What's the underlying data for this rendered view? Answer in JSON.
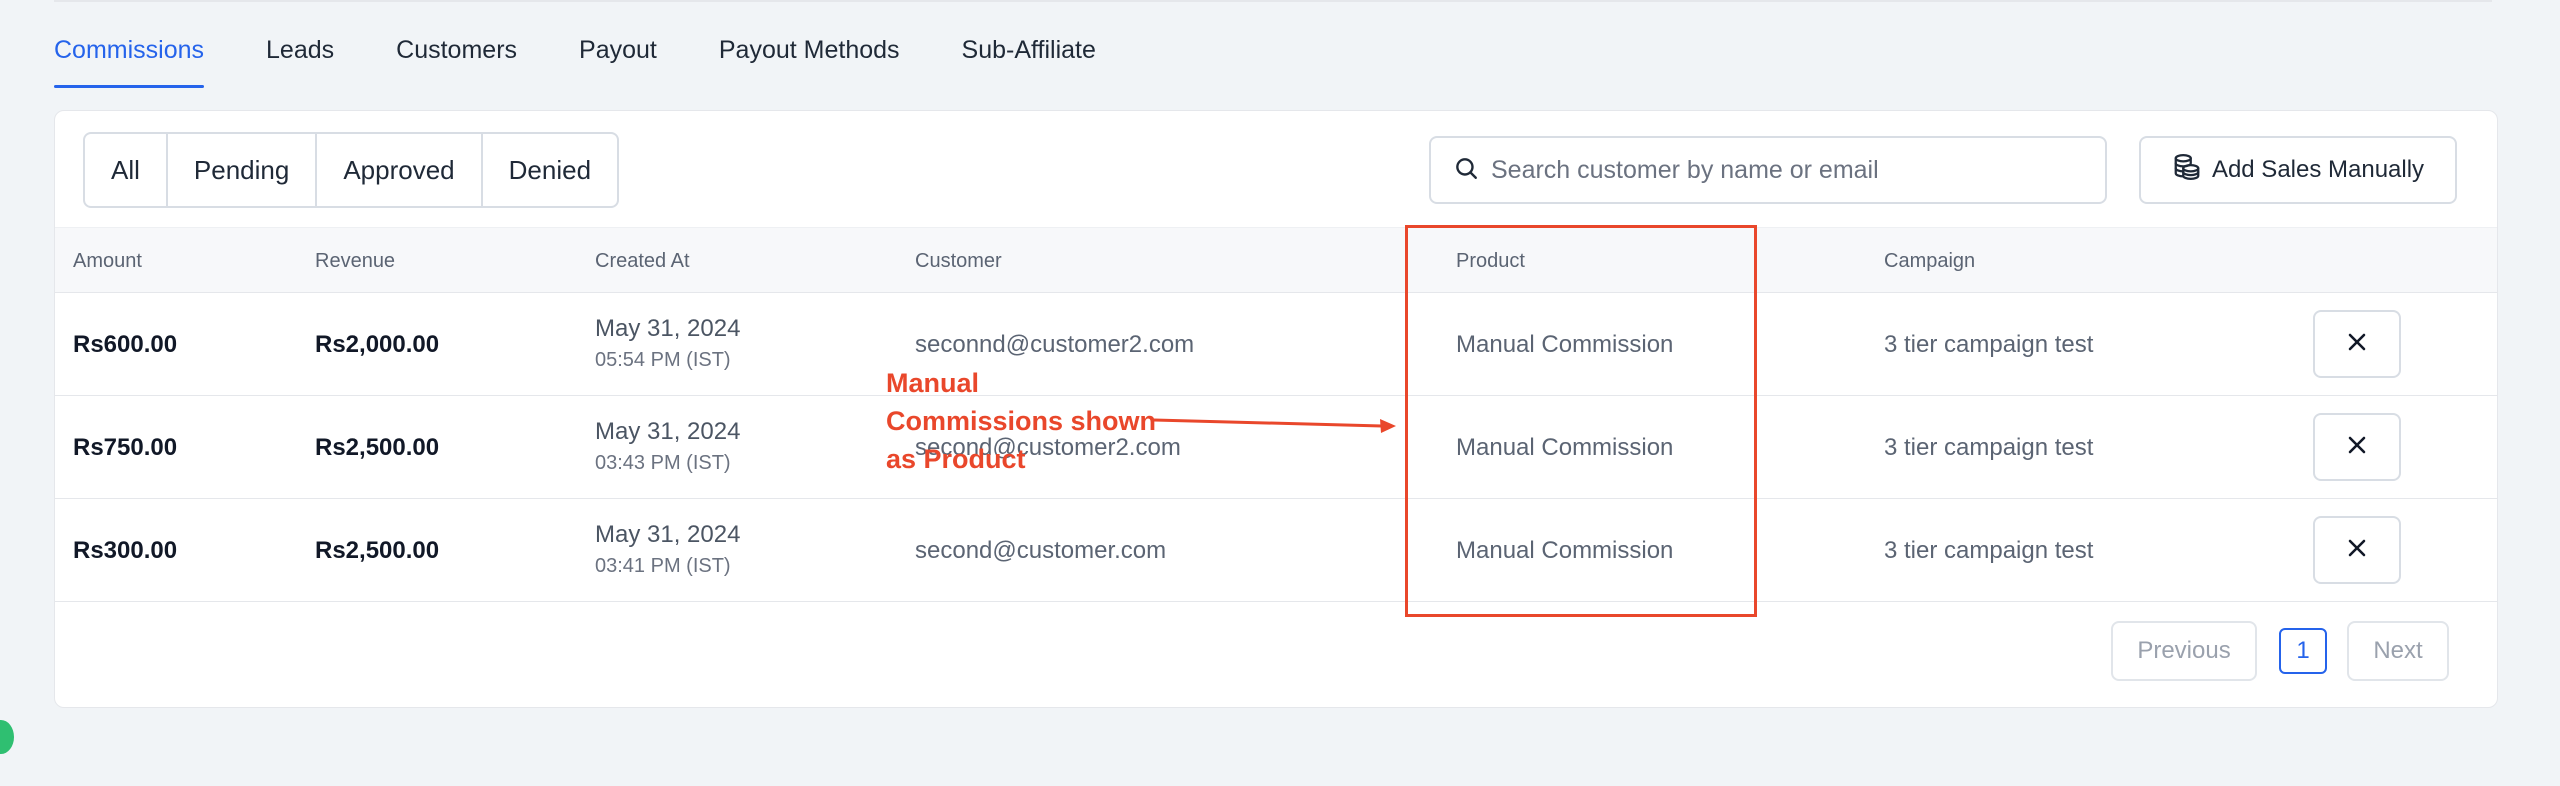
{
  "tabs": [
    "Commissions",
    "Leads",
    "Customers",
    "Payout",
    "Payout Methods",
    "Sub-Affiliate"
  ],
  "active_tab": "Commissions",
  "filters": [
    "All",
    "Pending",
    "Approved",
    "Denied"
  ],
  "search": {
    "placeholder": "Search customer by name or email"
  },
  "add_sales_label": "Add Sales Manually",
  "table": {
    "columns": [
      "Amount",
      "Revenue",
      "Created At",
      "Customer",
      "Product",
      "Campaign"
    ],
    "rows": [
      {
        "amount": "Rs600.00",
        "revenue": "Rs2,000.00",
        "date": "May 31, 2024",
        "time": "05:54 PM (IST)",
        "customer": "seconnd@customer2.com",
        "product": "Manual Commission",
        "campaign": "3 tier campaign test"
      },
      {
        "amount": "Rs750.00",
        "revenue": "Rs2,500.00",
        "date": "May 31, 2024",
        "time": "03:43 PM (IST)",
        "customer": "second@customer2.com",
        "product": "Manual Commission",
        "campaign": "3 tier campaign test"
      },
      {
        "amount": "Rs300.00",
        "revenue": "Rs2,500.00",
        "date": "May 31, 2024",
        "time": "03:41 PM (IST)",
        "customer": "second@customer.com",
        "product": "Manual Commission",
        "campaign": "3 tier campaign test"
      }
    ]
  },
  "pagination": {
    "previous": "Previous",
    "current": "1",
    "next": "Next"
  },
  "annotation": {
    "line1": "Manual",
    "line2": "Commissions shown",
    "line3": "as Product",
    "color": "#e9472b"
  },
  "colors": {
    "accent": "#2563eb",
    "annotation": "#e9472b",
    "background": "#f1f4f7"
  }
}
